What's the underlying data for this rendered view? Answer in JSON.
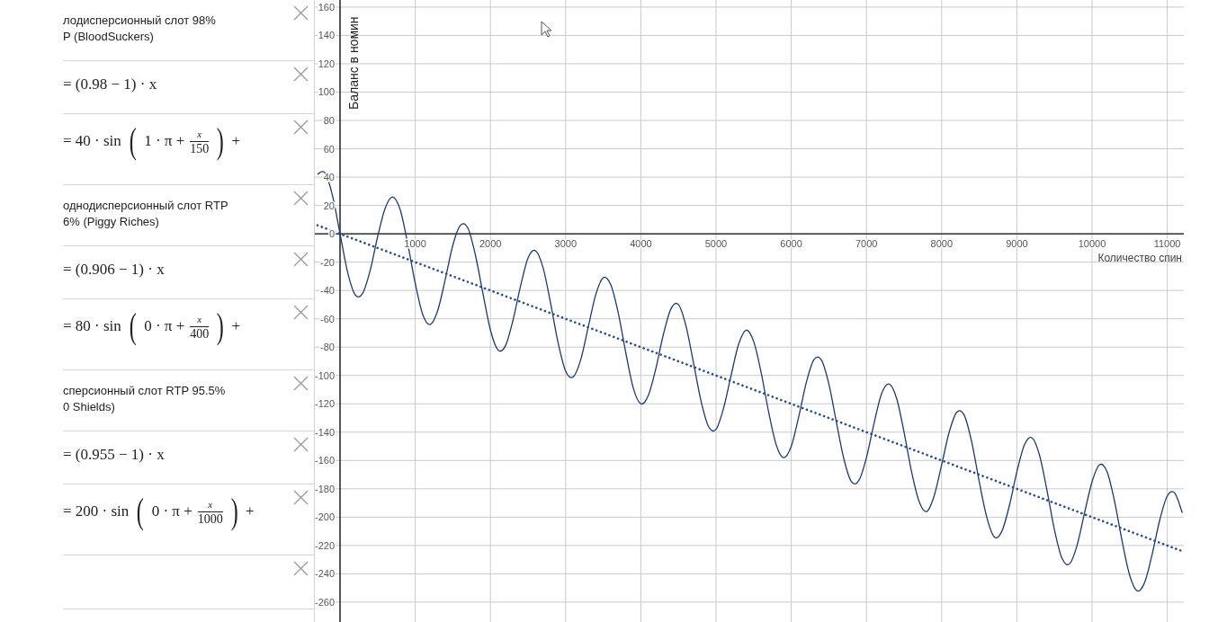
{
  "expressions": [
    {
      "kind": "note",
      "lines": [
        "лодисперсионный слот 98%",
        "P (BloodSuckers)"
      ]
    },
    {
      "kind": "linear",
      "text": "= (0.98 − 1) · x"
    },
    {
      "kind": "sine",
      "prefix": "= 40 · sin",
      "open": "(",
      "close": ")",
      "inner": "1 · π +",
      "numerator": "x",
      "denominator": "150",
      "suffix": "+"
    },
    {
      "kind": "note",
      "lines": [
        "однодисперсионный слот RTP",
        "6% (Piggy Riches)"
      ]
    },
    {
      "kind": "linear",
      "text": "= (0.906 − 1) · x"
    },
    {
      "kind": "sine",
      "prefix": "= 80 · sin",
      "open": "(",
      "close": ")",
      "inner": "0 · π +",
      "numerator": "x",
      "denominator": "400",
      "suffix": "+"
    },
    {
      "kind": "note",
      "lines": [
        "сперсионный слот RTP 95.5%",
        "0 Shields)"
      ]
    },
    {
      "kind": "linear",
      "text": "= (0.955 − 1) · x"
    },
    {
      "kind": "sine",
      "prefix": "= 200 · sin",
      "open": "(",
      "close": ")",
      "inner": "0 · π +",
      "numerator": "x",
      "denominator": "1000",
      "suffix": "+"
    },
    {
      "kind": "empty"
    }
  ],
  "graph": {
    "chart_data": {
      "type": "line",
      "grid": true,
      "ylabel": "Баланс в номин",
      "xlabel": "Количество спин",
      "xlim": [
        -335,
        11220
      ],
      "ylim": [
        -274,
        165
      ],
      "xticks": [
        1000,
        2000,
        3000,
        4000,
        5000,
        6000,
        7000,
        8000,
        9000,
        10000,
        11000
      ],
      "yticks": [
        -260,
        -240,
        -220,
        -200,
        -180,
        -160,
        -140,
        -120,
        -100,
        -80,
        -60,
        -40,
        -20,
        0,
        20,
        40,
        60,
        80,
        100,
        120,
        140,
        160
      ],
      "x": [
        -300,
        -200,
        -100,
        0,
        100,
        200,
        300,
        400,
        500,
        600,
        700,
        800,
        900,
        1000,
        1100,
        1200,
        1300,
        1400,
        1500,
        1600,
        1700,
        1800,
        1900,
        2000,
        2100,
        2200,
        2300,
        2400,
        2500,
        2600,
        2700,
        2800,
        2900,
        3000,
        3100,
        3200,
        3300,
        3400,
        3500,
        3600,
        3700,
        3800,
        3900,
        4000,
        4100,
        4200,
        4300,
        4400,
        4500,
        4600,
        4700,
        4800,
        4900,
        5000,
        5100,
        5200,
        5300,
        5400,
        5500,
        5600,
        5700,
        5800,
        5900,
        6000,
        6100,
        6200,
        6300,
        6400,
        6500,
        6600,
        6700,
        6800,
        6900,
        7000,
        7100,
        7200,
        7300,
        7400,
        7500,
        7600,
        7700,
        7800,
        7900,
        8000,
        8100,
        8200,
        8300,
        8400,
        8500,
        8600,
        8700,
        8800,
        8900,
        9000,
        9100,
        9200,
        9300,
        9400,
        9500,
        9600,
        9700,
        9800,
        9900,
        10000,
        10100,
        10200,
        10300,
        10400,
        10500,
        10600,
        10700,
        10800,
        10900,
        11000,
        11100,
        11200
      ],
      "series": [
        {
          "color": "#1f3a68",
          "line_style": "solid",
          "values": [
            42,
            43,
            27,
            0,
            -27,
            -43,
            -42,
            -26,
            -2,
            18,
            26,
            17,
            -7,
            -35,
            -57,
            -64,
            -54,
            -32,
            -8,
            6,
            4,
            -15,
            -42,
            -68,
            -82,
            -79,
            -61,
            -37,
            -17,
            -12,
            -24,
            -49,
            -77,
            -97,
            -101,
            -89,
            -66,
            -43,
            -31,
            -36,
            -56,
            -84,
            -109,
            -120,
            -114,
            -95,
            -71,
            -53,
            -50,
            -65,
            -91,
            -118,
            -136,
            -138,
            -123,
            -100,
            -78,
            -68,
            -76,
            -98,
            -126,
            -149,
            -158,
            -150,
            -129,
            -105,
            -89,
            -89,
            -106,
            -133,
            -159,
            -175,
            -174,
            -158,
            -134,
            -113,
            -106,
            -116,
            -140,
            -168,
            -189,
            -196,
            -185,
            -163,
            -140,
            -126,
            -128,
            -147,
            -175,
            -200,
            -214,
            -210,
            -192,
            -168,
            -149,
            -144,
            -156,
            -181,
            -209,
            -229,
            -233,
            -220,
            -197,
            -175,
            -163,
            -168,
            -189,
            -217,
            -241,
            -252,
            -246,
            -226,
            -202,
            -185,
            -183,
            -197
          ]
        },
        {
          "color": "#2c4f86",
          "line_style": "dotted",
          "values": [
            6,
            4,
            2,
            0,
            -2,
            -4,
            -6,
            -8,
            -10,
            -12,
            -14,
            -16,
            -18,
            -20,
            -22,
            -24,
            -26,
            -28,
            -30,
            -32,
            -34,
            -36,
            -38,
            -40,
            -42,
            -44,
            -46,
            -48,
            -50,
            -52,
            -54,
            -56,
            -58,
            -60,
            -62,
            -64,
            -66,
            -68,
            -70,
            -72,
            -74,
            -76,
            -78,
            -80,
            -82,
            -84,
            -86,
            -88,
            -90,
            -92,
            -94,
            -96,
            -98,
            -100,
            -102,
            -104,
            -106,
            -108,
            -110,
            -112,
            -114,
            -116,
            -118,
            -120,
            -122,
            -124,
            -126,
            -128,
            -130,
            -132,
            -134,
            -136,
            -138,
            -140,
            -142,
            -144,
            -146,
            -148,
            -150,
            -152,
            -154,
            -156,
            -158,
            -160,
            -162,
            -164,
            -166,
            -168,
            -170,
            -172,
            -174,
            -176,
            -178,
            -180,
            -182,
            -184,
            -186,
            -188,
            -190,
            -192,
            -194,
            -196,
            -198,
            -200,
            -202,
            -204,
            -206,
            -208,
            -210,
            -212,
            -214,
            -216,
            -218,
            -220,
            -222,
            -224
          ]
        }
      ]
    }
  }
}
